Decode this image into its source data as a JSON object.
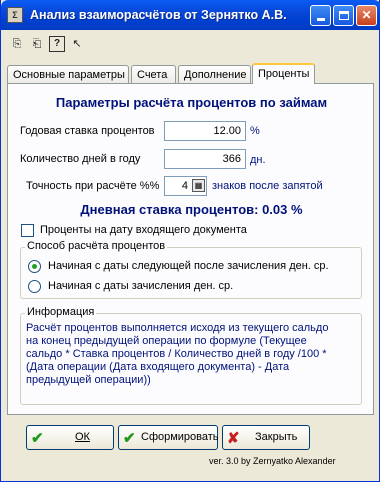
{
  "window": {
    "title": "Анализ взаиморасчётов от Зернятко А.В."
  },
  "tabs": [
    "Основные параметры",
    "Счета",
    "Дополнение",
    "Проценты"
  ],
  "heading": "Параметры расчёта процентов по займам",
  "fields": {
    "annual_rate": {
      "label": "Годовая ставка процентов",
      "value": "12.00",
      "unit": "%"
    },
    "days_in_year": {
      "label": "Количество дней в году",
      "value": "366",
      "unit": "дн."
    },
    "precision": {
      "label": "Точность при расчёте %%",
      "value": "4",
      "unit": "знаков после запятой"
    }
  },
  "daily_rate": "Дневная ставка процентов: 0.03 %",
  "checkbox_label": "Проценты на дату входящего документа",
  "method_group": {
    "title": "Способ расчёта процентов",
    "options": [
      "Начиная с даты следующей после зачисления ден. ср.",
      "Начиная с даты зачисления ден. ср."
    ]
  },
  "info": {
    "title": "Информация",
    "lines": [
      "Расчёт процентов выполняется исходя из текущего сальдо",
      "на конец предыдущей операции по формуле (Текущее",
      "сальдо * Ставка процентов / Количество дней в году /100 *",
      "(Дата операции (Дата входящего документа) - Дата",
      "предыдущей операции))"
    ]
  },
  "buttons": {
    "ok": "ОК",
    "generate": "Сформировать",
    "close": "Закрыть"
  },
  "version": "ver. 3.0 by Zernyatko Alexander"
}
